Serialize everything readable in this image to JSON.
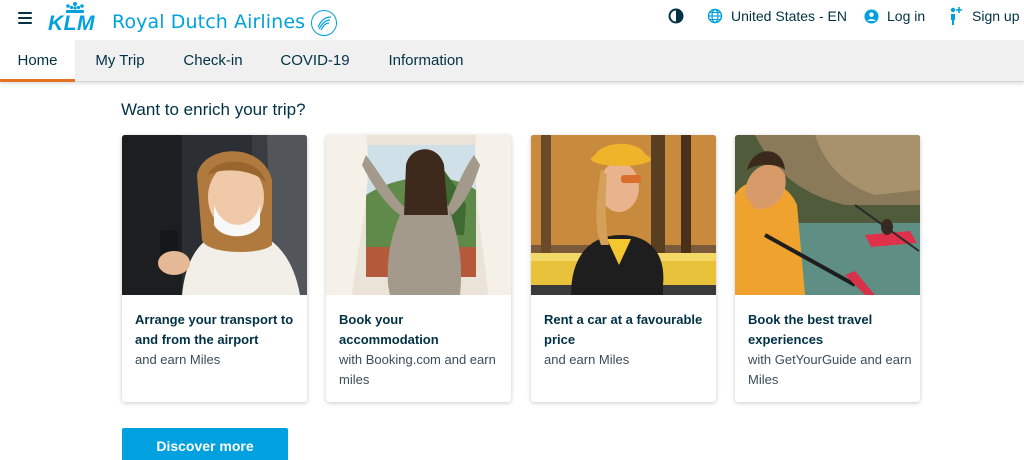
{
  "header": {
    "menu_icon": "hamburger-menu-icon",
    "logo_text": "KLM",
    "brand_name": "Royal Dutch Airlines",
    "alliance_logo": "skyteam-icon",
    "contrast_icon": "contrast-icon",
    "language_label": "United States - EN",
    "login_label": "Log in",
    "signup_label": "Sign up"
  },
  "nav": {
    "tabs": [
      {
        "label": "Home",
        "active": true
      },
      {
        "label": "My Trip",
        "active": false
      },
      {
        "label": "Check-in",
        "active": false
      },
      {
        "label": "COVID-19",
        "active": false
      },
      {
        "label": "Information",
        "active": false
      }
    ]
  },
  "main": {
    "heading": "Want to enrich your trip?",
    "cards": [
      {
        "title": "Arrange your transport to and from the airport",
        "subtitle": "and earn Miles"
      },
      {
        "title": "Book your accommodation",
        "subtitle": "with Booking.com and earn miles"
      },
      {
        "title": "Rent a car at a favourable price",
        "subtitle": "and earn Miles"
      },
      {
        "title": "Book the best travel experiences",
        "subtitle": "with GetYourGuide and earn Miles"
      }
    ],
    "cta_label": "Discover more"
  },
  "colors": {
    "brand_blue": "#00a1de",
    "text_navy": "#003145",
    "active_tab_accent": "#e37222"
  }
}
